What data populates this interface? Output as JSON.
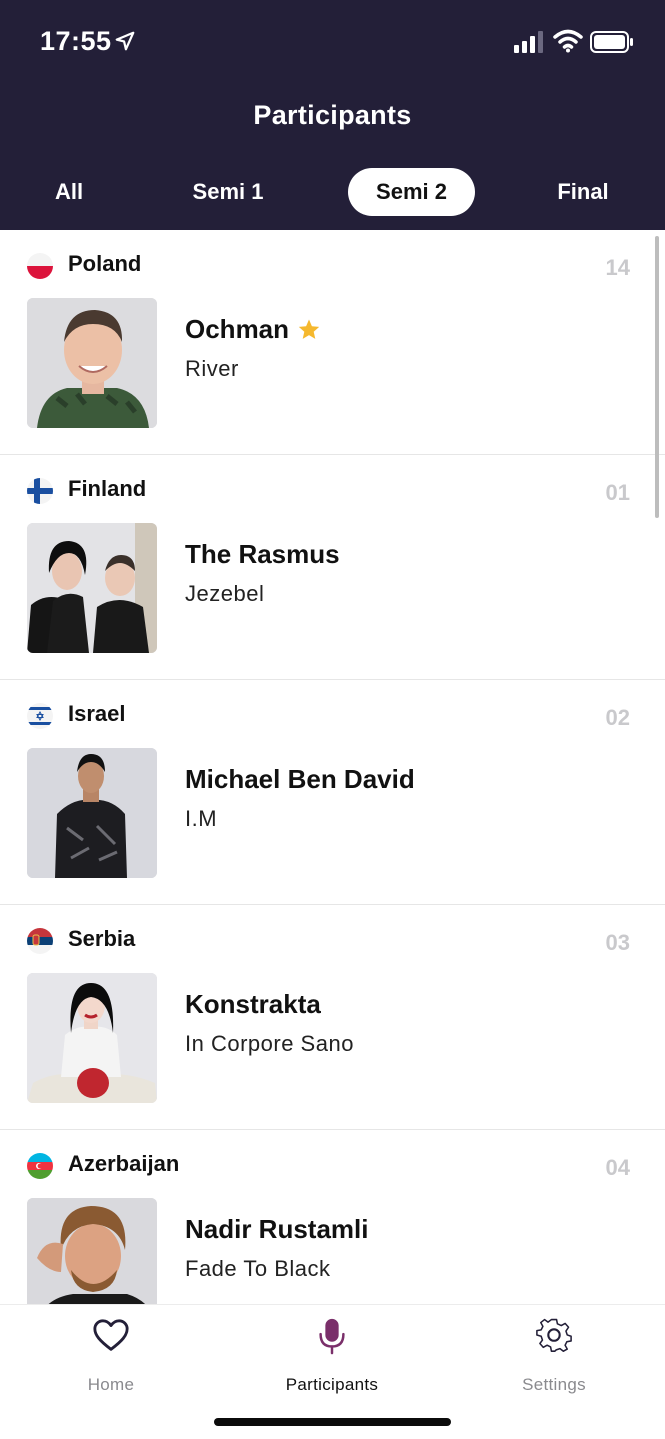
{
  "status_bar": {
    "time": "17:55"
  },
  "header": {
    "title": "Participants"
  },
  "tabs": [
    {
      "label": "All",
      "active": false
    },
    {
      "label": "Semi 1",
      "active": false
    },
    {
      "label": "Semi 2",
      "active": true
    },
    {
      "label": "Final",
      "active": false
    }
  ],
  "entries": [
    {
      "country": "Poland",
      "order": "14",
      "artist": "Ochman",
      "song": "River",
      "favorite": true,
      "flag": "poland-flag-icon"
    },
    {
      "country": "Finland",
      "order": "01",
      "artist": "The Rasmus",
      "song": "Jezebel",
      "favorite": false,
      "flag": "finland-flag-icon"
    },
    {
      "country": "Israel",
      "order": "02",
      "artist": "Michael Ben David",
      "song": "I.M",
      "favorite": false,
      "flag": "israel-flag-icon"
    },
    {
      "country": "Serbia",
      "order": "03",
      "artist": "Konstrakta",
      "song": "In Corpore Sano",
      "favorite": false,
      "flag": "serbia-flag-icon"
    },
    {
      "country": "Azerbaijan",
      "order": "04",
      "artist": "Nadir Rustamli",
      "song": "Fade To Black",
      "favorite": false,
      "flag": "azerbaijan-flag-icon"
    }
  ],
  "tabbar": {
    "home": "Home",
    "participants": "Participants",
    "settings": "Settings"
  },
  "colors": {
    "header_bg": "#231f38",
    "star": "#f5b82e",
    "participants_icon": "#7a2f6a",
    "order_number": "#c9c9cc"
  }
}
